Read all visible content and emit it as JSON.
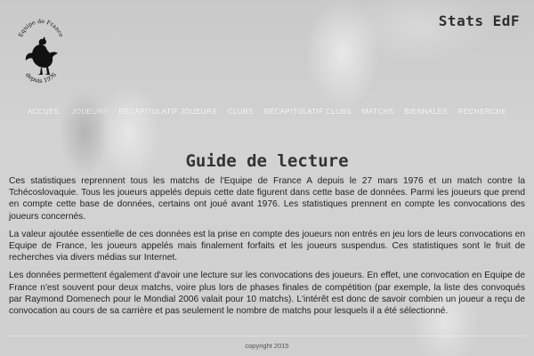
{
  "header": {
    "logo_text_top": "Equipe de France",
    "logo_text_bottom": "depuis 1976",
    "site_title": "Stats EdF"
  },
  "nav": {
    "items": [
      {
        "label": "ACCUEIL"
      },
      {
        "label": "JOUEURS"
      },
      {
        "label": "RÉCAPITULATIF JOUEURS"
      },
      {
        "label": "CLUBS"
      },
      {
        "label": "RÉCAPITULATIF CLUBS"
      },
      {
        "label": "MATCHS"
      },
      {
        "label": "BIENNALES"
      },
      {
        "label": "RECHERCHE"
      }
    ]
  },
  "main": {
    "title": "Guide de lecture",
    "paragraphs": [
      "Ces statistiques reprennent tous les matchs de l'Equipe de France A depuis le 27 mars 1976 et un match contre la Tchécoslovaquie. Tous les joueurs appelés depuis cette date figurent dans cette base de données. Parmi les joueurs que prend en compte cette base de données, certains ont joué avant 1976. Les statistiques prennent en compte les convocations des joueurs concernés.",
      "La valeur ajoutée essentielle de ces données est la prise en compte des joueurs non entrés en jeu lors de leurs convocations en Equipe de France, les joueurs appelés mais finalement forfaits et les joueurs suspendus. Ces statistiques sont le fruit de recherches via divers médias sur Internet.",
      "Les données permettent également d'avoir une lecture sur les convocations des joueurs. En effet, une convocation en Equipe de France n'est souvent pour deux matchs, voire plus lors de phases finales de compétition (par exemple, la liste des convoqués par Raymond Domenech pour le Mondial 2006 valait pour 10 matchs). L'intérêt est donc de savoir combien un joueur a reçu de convocation au cours de sa carrière et pas seulement le nombre de matchs pour lesquels il a été sélectionné."
    ]
  },
  "footer": {
    "copyright": "copyright 2015"
  }
}
